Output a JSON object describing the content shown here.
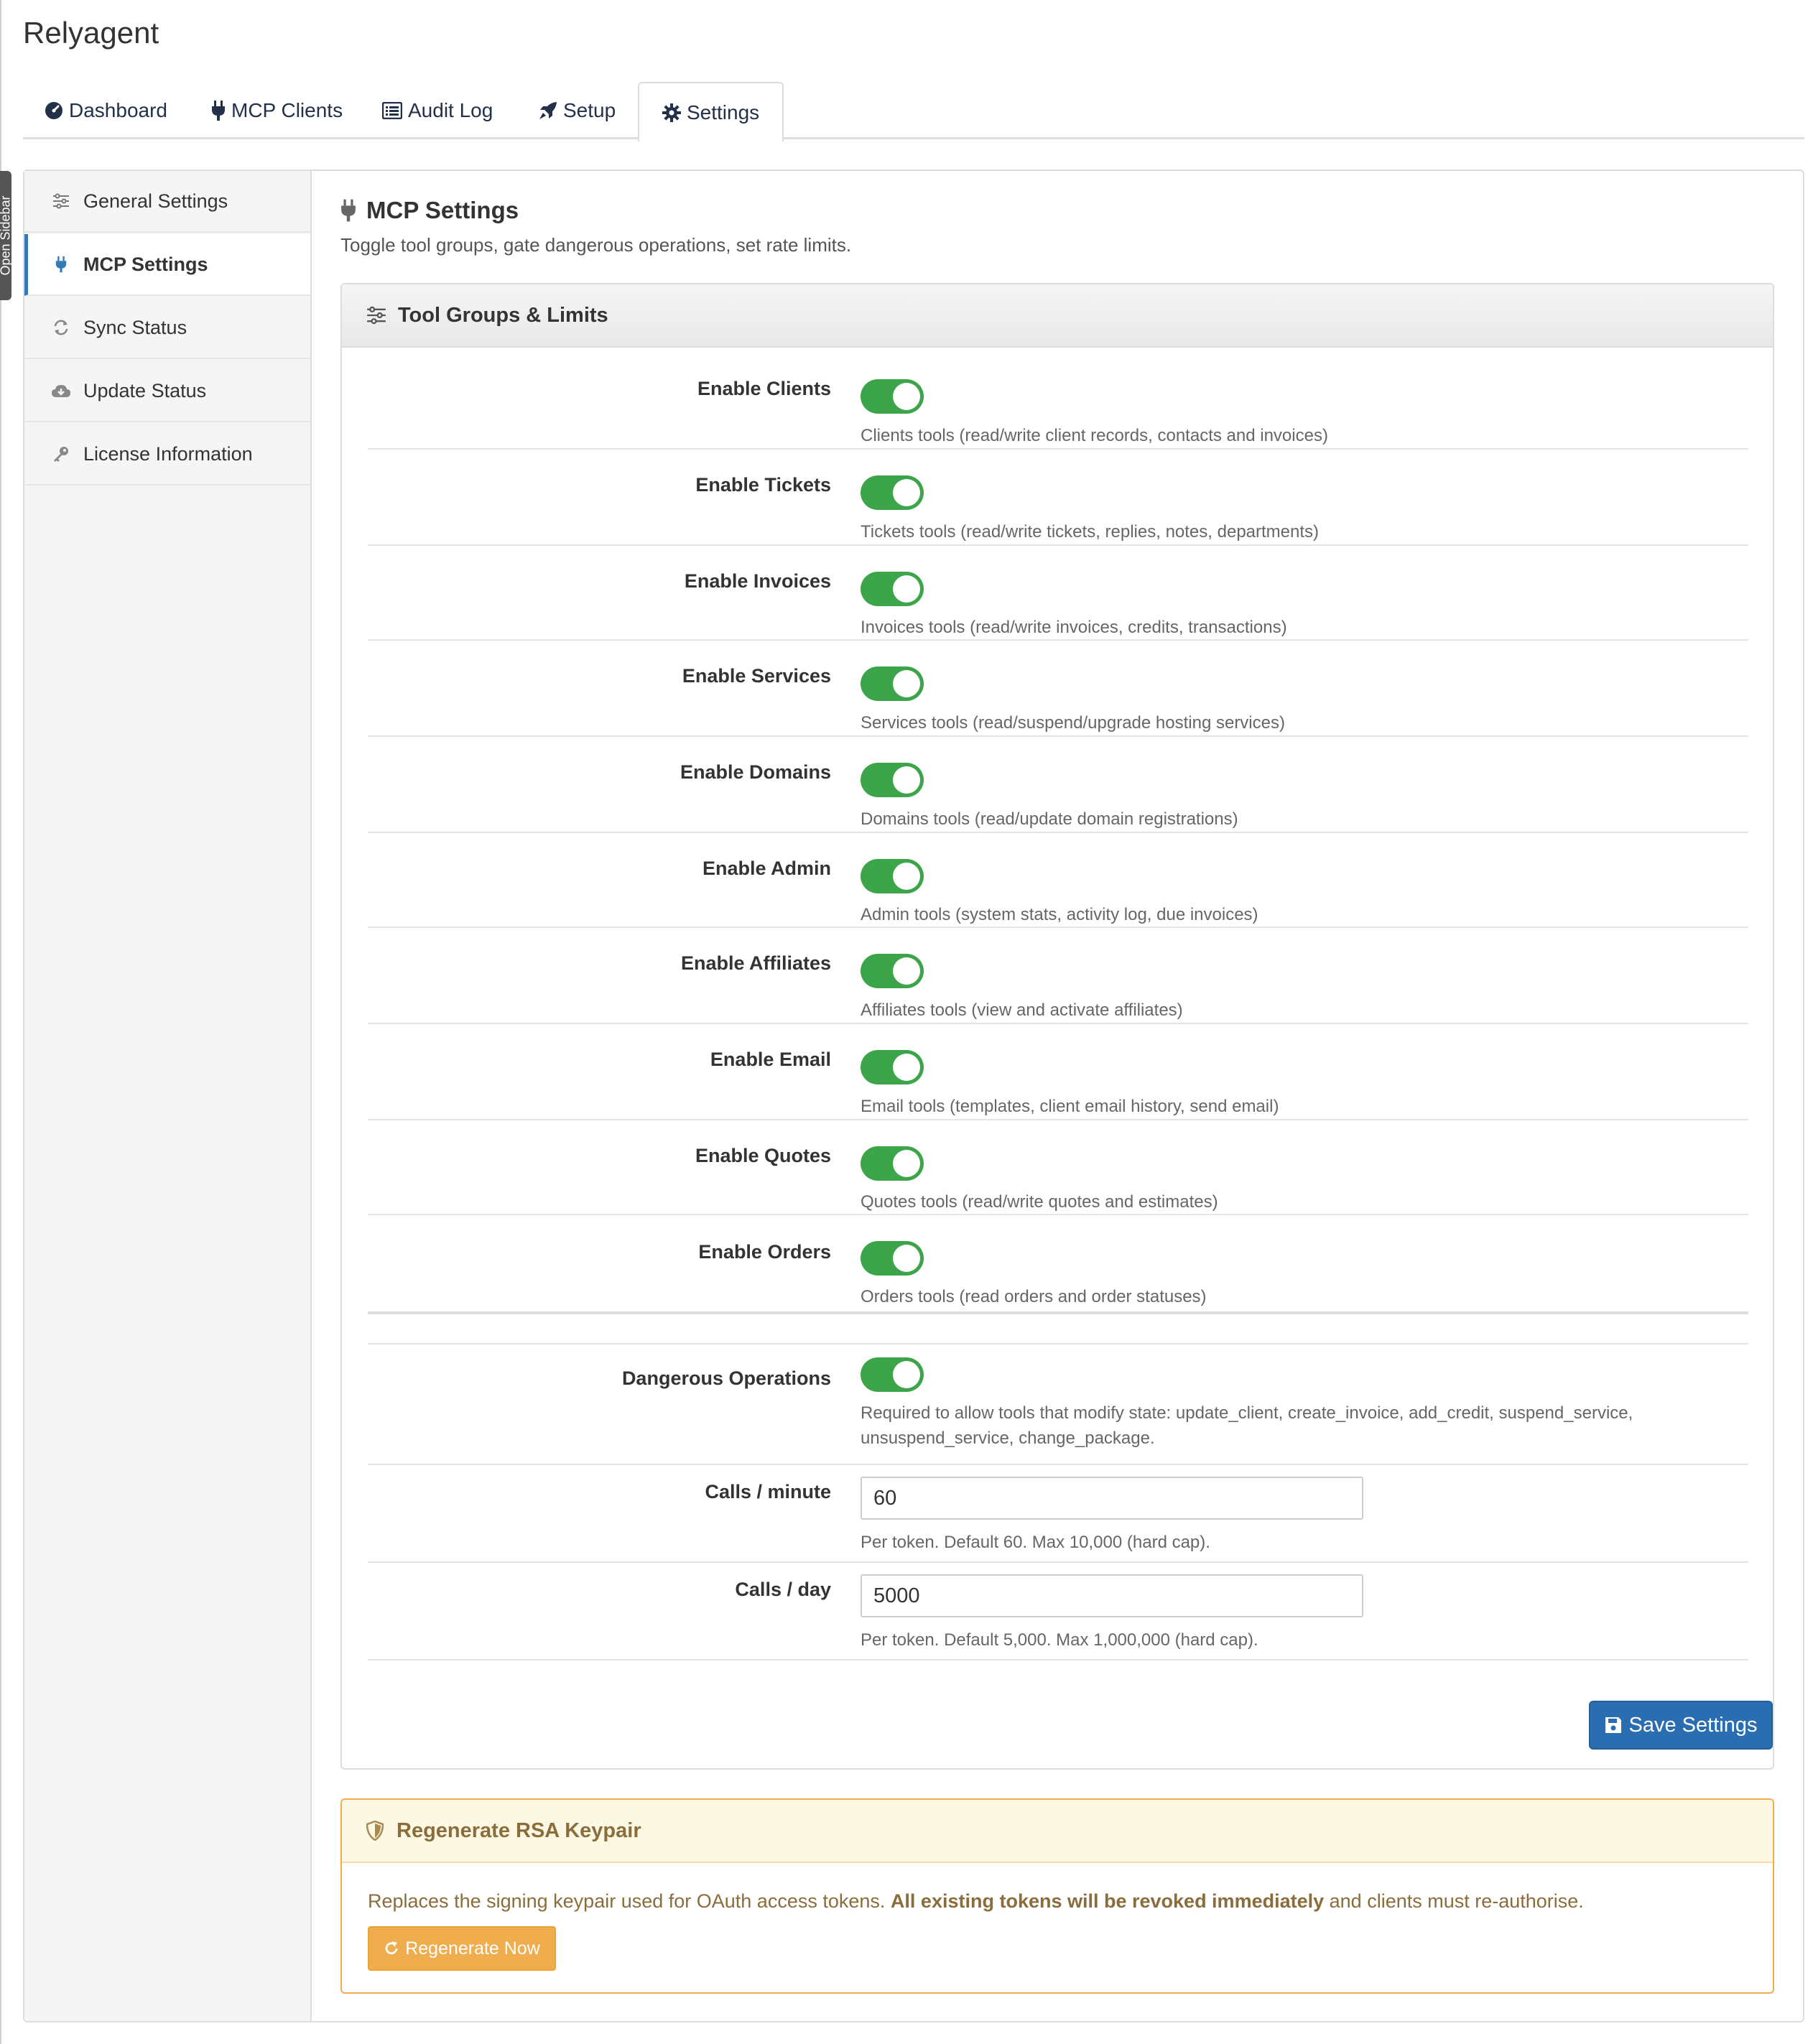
{
  "app": {
    "title": "Relyagent"
  },
  "open_sidebar": {
    "label": "Open Sidebar"
  },
  "tabs": [
    {
      "label": "Dashboard",
      "icon": "dashboard-icon"
    },
    {
      "label": "MCP Clients",
      "icon": "plug-icon"
    },
    {
      "label": "Audit Log",
      "icon": "list-icon"
    },
    {
      "label": "Setup",
      "icon": "rocket-icon"
    },
    {
      "label": "Settings",
      "icon": "gear-icon",
      "active": true
    }
  ],
  "sidebar": {
    "items": [
      {
        "label": "General Settings",
        "icon": "sliders-icon"
      },
      {
        "label": "MCP Settings",
        "icon": "plug-icon",
        "active": true
      },
      {
        "label": "Sync Status",
        "icon": "refresh-icon"
      },
      {
        "label": "Update Status",
        "icon": "cloud-download-icon"
      },
      {
        "label": "License Information",
        "icon": "key-icon"
      }
    ]
  },
  "main": {
    "title": "MCP Settings",
    "subtitle": "Toggle tool groups, gate dangerous operations, set rate limits."
  },
  "panel": {
    "title": "Tool Groups & Limits",
    "toggles": [
      {
        "label": "Enable Clients",
        "help": "Clients tools (read/write client records, contacts and invoices)",
        "enabled": true
      },
      {
        "label": "Enable Tickets",
        "help": "Tickets tools (read/write tickets, replies, notes, departments)",
        "enabled": true
      },
      {
        "label": "Enable Invoices",
        "help": "Invoices tools (read/write invoices, credits, transactions)",
        "enabled": true
      },
      {
        "label": "Enable Services",
        "help": "Services tools (read/suspend/upgrade hosting services)",
        "enabled": true
      },
      {
        "label": "Enable Domains",
        "help": "Domains tools (read/update domain registrations)",
        "enabled": true
      },
      {
        "label": "Enable Admin",
        "help": "Admin tools (system stats, activity log, due invoices)",
        "enabled": true
      },
      {
        "label": "Enable Affiliates",
        "help": "Affiliates tools (view and activate affiliates)",
        "enabled": true
      },
      {
        "label": "Enable Email",
        "help": "Email tools (templates, client email history, send email)",
        "enabled": true
      },
      {
        "label": "Enable Quotes",
        "help": "Quotes tools (read/write quotes and estimates)",
        "enabled": true
      },
      {
        "label": "Enable Orders",
        "help": "Orders tools (read orders and order statuses)",
        "enabled": true
      }
    ],
    "dangerous": {
      "label": "Dangerous Operations",
      "help_line1": "Required to allow tools that modify state: update_client, create_invoice, add_credit, suspend_service,",
      "help_line2": "unsuspend_service, change_package.",
      "enabled": true
    },
    "calls_minute": {
      "label": "Calls / minute",
      "value": "60",
      "help": "Per token. Default 60. Max 10,000 (hard cap)."
    },
    "calls_day": {
      "label": "Calls / day",
      "value": "5000",
      "help": "Per token. Default 5,000. Max 1,000,000 (hard cap)."
    },
    "save_label": "Save Settings"
  },
  "rsa": {
    "title": "Regenerate RSA Keypair",
    "text_before": "Replaces the signing keypair used for OAuth access tokens.",
    "text_bold": "All existing tokens will be revoked immediately",
    "text_after": "and clients must re-authorise.",
    "button_label": "Regenerate Now"
  },
  "colors": {
    "accent": "#337ab7",
    "toggle_on": "#3da549",
    "save_button": "#2a6db0",
    "warning": "#f0ad4e",
    "warning_text": "#8a6d3b"
  }
}
